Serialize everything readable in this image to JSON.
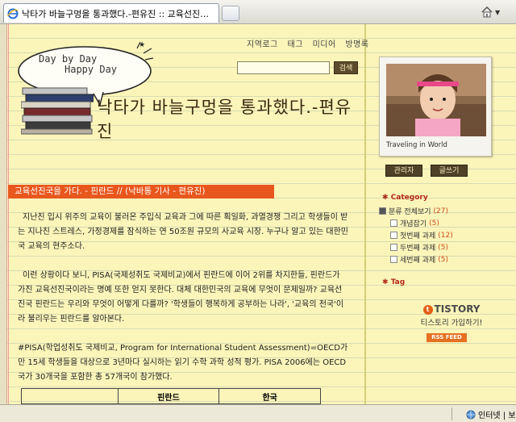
{
  "browser": {
    "tab_title": "낙타가 바늘구멍을 통과했다.-편유진 :: 교육선진…",
    "status_zone": "인터넷 | 보"
  },
  "header": {
    "nav": [
      "지역로그",
      "태그",
      "미디어",
      "방명록"
    ],
    "bubble_line1": "Day by Day",
    "bubble_line2": "Happy Day",
    "search_button": "검색",
    "blog_title": "낙타가 바늘구멍을 통과했다.-편유진"
  },
  "post": {
    "title": "교육선진국을 가다. - 핀란드 // (낙바통 기사 - 편유진)",
    "paragraphs": [
      "지난친 입시 위주의 교육이 불러온 주입식 교육과 그에 따른 획일화, 과열경쟁 그리고 학생들이 받는 지나친 스트레스, 가정경제를 잠식하는 연 50조원 규모의 사교육 시장. 누구나 알고 있는 대한민국 교육의 현주소다.",
      "이런 상황이다 보니, PISA(국제성취도 국제비교)에서 핀란드에 이어 2위를 차지한들, 핀란드가 가진 교육선진국이라는 명예 또한 얻지 못한다. 대체 대한민국의 교육에 무엇이 문제일까? 교육선진국 핀란드는 우리와 무엇이 어떻게  다를까? '학생들이 행복하게 공부하는 나라', '교육의 천국'이라 불리우는 핀란드를 알아본다.",
      "#PISA(학업성취도 국제비교, Program for International Student Assessment)=OECD가 만 15세 학생들을 대상으로 3년마다 실시하는 읽기 수학 과학 성적 평가. PISA 2006에는 OECD국가 30개국을 포함한 총 57개국이 참가했다."
    ],
    "table_headers": [
      "",
      "핀란드",
      "한국"
    ]
  },
  "sidebar": {
    "photo_caption": "Traveling in World",
    "admin_button": "관리자",
    "write_button": "글쓰기",
    "category_header": "Category",
    "categories": [
      {
        "label": "분류 전체보기",
        "count": "(27)",
        "sub": false
      },
      {
        "label": "개념잡기",
        "count": "(5)",
        "sub": true
      },
      {
        "label": "첫번째 과제",
        "count": "(12)",
        "sub": true
      },
      {
        "label": "두번째 과제",
        "count": "(5)",
        "sub": true
      },
      {
        "label": "세번째 과제",
        "count": "(5)",
        "sub": true
      }
    ],
    "tag_header": "Tag",
    "tistory_logo": "TISTORY",
    "tistory_join": "티스토리 가입하기!",
    "rss": "RSS FEED"
  },
  "colors": {
    "paper": "#fbf5ba",
    "title_bar": "#e8571d",
    "category_red": "#b22a1a",
    "button_brown": "#4f4127"
  }
}
